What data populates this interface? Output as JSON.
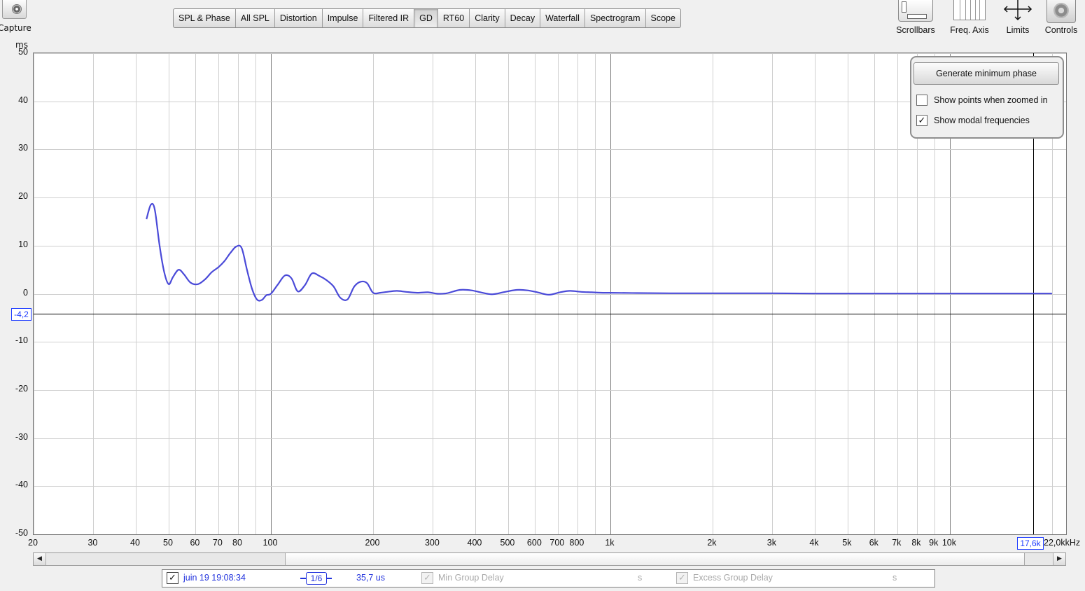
{
  "toolbar": {
    "capture_label": "Capture",
    "tabs": [
      "SPL & Phase",
      "All SPL",
      "Distortion",
      "Impulse",
      "Filtered IR",
      "GD",
      "RT60",
      "Clarity",
      "Decay",
      "Waterfall",
      "Spectrogram",
      "Scope"
    ],
    "active_tab": "GD",
    "scrollbars_label": "Scrollbars",
    "freq_axis_label": "Freq. Axis",
    "limits_label": "Limits",
    "controls_label": "Controls"
  },
  "controls_panel": {
    "generate_label": "Generate minimum phase",
    "show_points_label": "Show points when zoomed in",
    "show_points_checked": false,
    "show_modal_label": "Show modal frequencies",
    "show_modal_checked": true
  },
  "cursor": {
    "y_value": "-4,2",
    "x_value": "17,6k"
  },
  "legend": {
    "measurement_checked": true,
    "measurement_name": "juin 19 19:08:34",
    "smoothing": "1/6",
    "value": "35,7 us",
    "min_gd_label": "Min Group Delay",
    "min_gd_unit": "s",
    "excess_gd_label": "Excess Group Delay",
    "excess_gd_unit": "s"
  },
  "colors": {
    "trace": "#4a4ad8",
    "cursor_box": "#1e3cff"
  },
  "chart_data": {
    "type": "line",
    "xscale": "log",
    "xlim": [
      20,
      22000
    ],
    "ylim": [
      -50,
      50
    ],
    "ylabel": "ms",
    "xunit": "kHz",
    "y_ticks": [
      "50",
      "40",
      "30",
      "20",
      "10",
      "0",
      "-10",
      "-20",
      "-30",
      "-40",
      "-50"
    ],
    "x_tick_labels": [
      "20",
      "30",
      "40",
      "50",
      "60",
      "70",
      "80",
      "100",
      "200",
      "300",
      "400",
      "500",
      "600",
      "700",
      "800",
      "1k",
      "2k",
      "3k",
      "4k",
      "5k",
      "6k",
      "7k",
      "8k",
      "9k",
      "10k",
      "22,0k"
    ],
    "x_tick_values": [
      20,
      30,
      40,
      50,
      60,
      70,
      80,
      100,
      200,
      300,
      400,
      500,
      600,
      700,
      800,
      1000,
      2000,
      3000,
      4000,
      5000,
      6000,
      7000,
      8000,
      9000,
      10000,
      22000
    ],
    "cursor_x": 17600,
    "cursor_y": -4.2,
    "series": [
      {
        "x": [
          43,
          44.3,
          45.5,
          47,
          48.5,
          50,
          51.5,
          53.5,
          55.5,
          58,
          61,
          64,
          67,
          70,
          73,
          76,
          79,
          82,
          85,
          88,
          91,
          94,
          97,
          100,
          105,
          110,
          115,
          120,
          126,
          132,
          139,
          146,
          153,
          160,
          168,
          176,
          184,
          192,
          200,
          210,
          220,
          235,
          250,
          270,
          290,
          310,
          330,
          360,
          390,
          420,
          450,
          490,
          530,
          570,
          610,
          660,
          710,
          760,
          820,
          880,
          950,
          1000,
          1200,
          1500,
          2000,
          3000,
          4000,
          5000,
          6000,
          8000,
          10000,
          15000,
          20000
        ],
        "y": [
          15.5,
          18.5,
          17.5,
          10,
          4.5,
          2,
          3.5,
          5,
          4,
          2.3,
          2,
          3,
          4.5,
          5.5,
          6.8,
          8.5,
          9.8,
          9.5,
          5,
          1,
          -1.2,
          -1.3,
          -0.3,
          0,
          2,
          3.8,
          3.2,
          0.5,
          1.8,
          4.2,
          3.7,
          2.8,
          1.5,
          -0.8,
          -1.2,
          1.5,
          2.5,
          2.2,
          0.2,
          0.2,
          0.4,
          0.6,
          0.4,
          0.2,
          0.3,
          0,
          0.1,
          0.8,
          0.7,
          0.2,
          -0.1,
          0.4,
          0.8,
          0.7,
          0.3,
          -0.2,
          0.3,
          0.6,
          0.4,
          0.3,
          0.2,
          0.2,
          0.15,
          0.1,
          0.1,
          0.1,
          0.05,
          0.05,
          0.05,
          0.05,
          0.05,
          0.05,
          0.05
        ]
      }
    ]
  }
}
